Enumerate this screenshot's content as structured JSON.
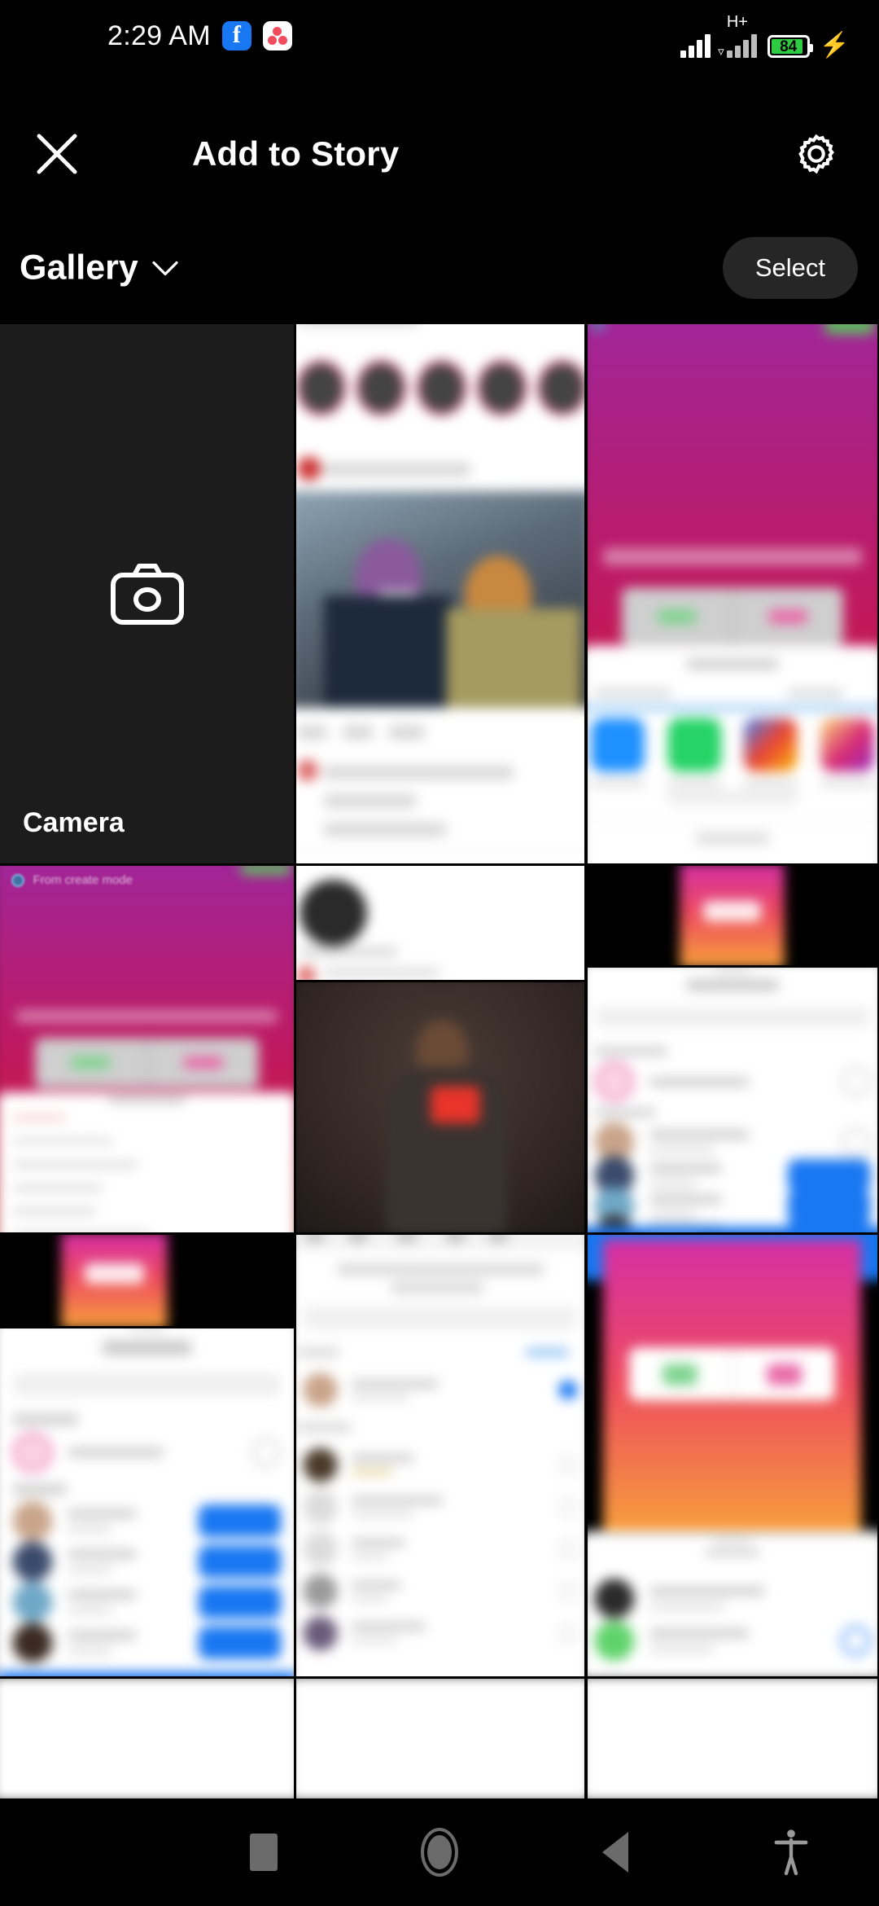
{
  "status_bar": {
    "time": "2:29 AM",
    "app_icons": [
      "facebook-icon",
      "dots-app-icon"
    ],
    "network_type": "H+",
    "battery_percent": "84",
    "battery_charging": true,
    "signal_icon": "signal-bars-icon",
    "colors": {
      "battery_fill": "#2ECC40",
      "facebook_blue": "#1877F2"
    }
  },
  "header": {
    "close_label": "✕",
    "title": "Add to Story",
    "settings_icon": "gear-icon"
  },
  "gallery_bar": {
    "source_label": "Gallery",
    "dropdown_icon": "chevron-down-icon",
    "select_label": "Select"
  },
  "grid": {
    "camera_tile": {
      "label": "Camera",
      "icon": "camera-icon"
    },
    "thumbnails": [
      {
        "id": 1,
        "kind": "instagram-feed-screenshot",
        "caption": ""
      },
      {
        "id": 2,
        "kind": "gradient-story-screenshot",
        "caption": ""
      },
      {
        "id": 3,
        "kind": "share-sheet-screenshot",
        "caption": ""
      },
      {
        "id": 4,
        "kind": "gradient-story-screenshot",
        "caption": "From create mode"
      },
      {
        "id": 5,
        "kind": "instagram-profile-screenshot",
        "caption": ""
      },
      {
        "id": 6,
        "kind": "story-thumbnail-gradient",
        "caption": ""
      },
      {
        "id": 7,
        "kind": "white-menu-sheet-screenshot",
        "caption": ""
      },
      {
        "id": 8,
        "kind": "portrait-photo",
        "caption": ""
      },
      {
        "id": 9,
        "kind": "share-to-list-screenshot",
        "caption": ""
      },
      {
        "id": 10,
        "kind": "story-thumbnail-gradient",
        "caption": ""
      },
      {
        "id": 11,
        "kind": "share-sheet-screenshot",
        "caption": ""
      },
      {
        "id": 12,
        "kind": "gradient-story-screenshot",
        "caption": ""
      },
      {
        "id": 13,
        "kind": "share-to-list-screenshot",
        "caption": ""
      },
      {
        "id": 14,
        "kind": "contact-list-screenshot",
        "caption": ""
      }
    ]
  },
  "nav_bar": {
    "recent_label": "recent-apps",
    "home_label": "home",
    "back_label": "back",
    "accessibility_label": "accessibility"
  }
}
